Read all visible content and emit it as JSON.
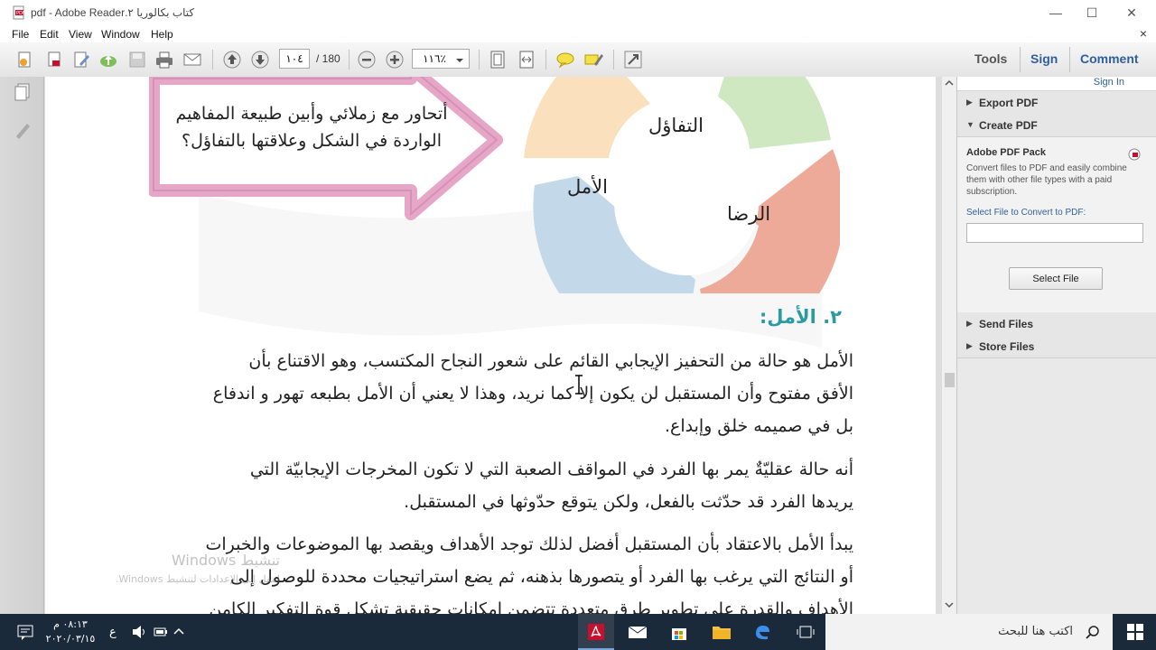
{
  "window": {
    "title": "كتاب بكالوريا ٢.pdf - Adobe Reader",
    "controls": {
      "minimize": "—",
      "maximize": "☐",
      "close": "✕"
    }
  },
  "menu": {
    "items": [
      "File",
      "Edit",
      "View",
      "Window",
      "Help"
    ],
    "close_glyph": "×"
  },
  "toolbar": {
    "page_current": "١٠٤",
    "page_total": "/ 180",
    "zoom": "١١٦٪",
    "tools_label": "Tools",
    "sign_label": "Sign",
    "comment_label": "Comment"
  },
  "document": {
    "callout_line1": "أتحاور مع زملائي وأبين طبيعة المفاهيم",
    "callout_line2": "الواردة في الشكل وعلاقتها بالتفاؤل؟",
    "diagram_center": "التفاؤل",
    "diagram_left": "الأمل",
    "diagram_right": "الرضا",
    "section_heading": "٢. الأمل:",
    "para1_line1": "الأمل هو حالة من التحفيز الإيجابي القائم على شعور النجاح المكتسب، وهو الاقتناع بأن",
    "para1_line2": "الأفق مفتوح وأن المستقبل لن يكون إلا كما نريد، وهذا لا يعني أن الأمل بطبعه تهور و اندفاع",
    "para1_line3": "بل في صميمه خلق وإبداع.",
    "para2_line1": "أنه حالة عقليّةٌ يمر بها الفرد في المواقف الصعبة التي لا تكون المخرجات الإيجابيّة التي",
    "para2_line2": "يريدها الفرد قد حدّثت بالفعل، ولكن يتوقع حدّوثها في المستقبل.",
    "para3_line1": "يبدأ الأمل بالاعتقاد بأن المستقبل أفضل لذلك توجد الأهداف ويقصد بها الموضوعات والخبرات",
    "para3_line2": "أو النتائج التي يرغب بها الفرد أو يتصورها بذهنه، ثم يضع استراتيجيات محددة للوصول إلى",
    "para3_line3": "الأهداف والقدرة على تطوير طرق متعددة تتضمن إمكانات حقيقية تشكل قوة التفكير الكامن",
    "watermark_title": "تنشيط Windows",
    "watermark_sub": "انتقل إلى الإعدادات لتنشيط Windows."
  },
  "right_pane": {
    "sign_in": "Sign In",
    "export_pdf": "Export PDF",
    "create_pdf": "Create PDF",
    "pack_title": "Adobe PDF Pack",
    "pack_desc": "Convert files to PDF and easily combine them with other file types with a paid subscription.",
    "select_label": "Select File to Convert to PDF:",
    "select_button": "Select File",
    "send_files": "Send Files",
    "store_files": "Store Files"
  },
  "taskbar": {
    "time": "٠٨:١٣ م",
    "date": "٢٠٢٠/٠٣/١٥",
    "lang": "ع",
    "search_placeholder": "اكتب هنا للبحث"
  },
  "colors": {
    "heading_teal": "#2a9aa3",
    "ring_orange": "#fbe0bd",
    "ring_green": "#cfe8c2",
    "ring_blue": "#c3d9ea",
    "ring_red": "#eeaa98",
    "callout_pink": "#e6a6c7"
  }
}
